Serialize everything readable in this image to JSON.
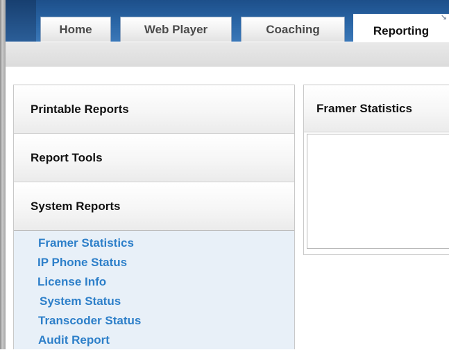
{
  "tabs": [
    {
      "label": "Home"
    },
    {
      "label": "Web Player"
    },
    {
      "label": "Coaching"
    },
    {
      "label": "Reporting",
      "active": true
    }
  ],
  "sidebar": {
    "sections": [
      {
        "label": "Printable Reports"
      },
      {
        "label": "Report Tools"
      },
      {
        "label": "System Reports",
        "expanded": true
      }
    ],
    "system_reports_items": [
      {
        "label": "Framer Statistics"
      },
      {
        "label": "IP Phone Status"
      },
      {
        "label": "License Info"
      },
      {
        "label": "System Status"
      },
      {
        "label": "Transcoder Status"
      },
      {
        "label": "Audit Report"
      }
    ]
  },
  "main": {
    "panel_title": "Framer Statistics"
  },
  "colors": {
    "header_blue": "#2a66a6",
    "link_blue": "#2d7fc9",
    "expanded_section_bg": "#e8f0f8"
  }
}
